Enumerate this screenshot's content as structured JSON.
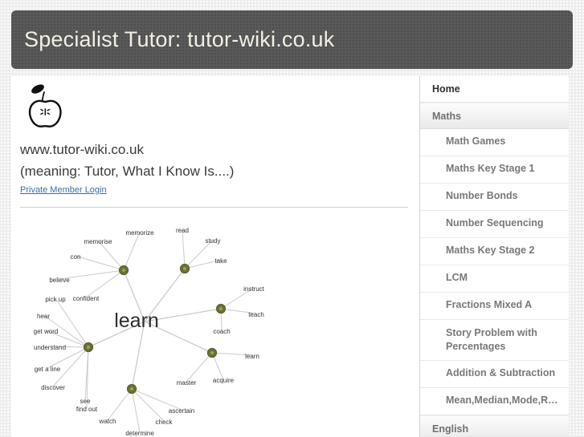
{
  "header": {
    "title": "Specialist Tutor: tutor-wiki.co.uk"
  },
  "logo": {
    "name": "apple-logo",
    "alt": "apple outline with leaf"
  },
  "intro": {
    "url_line": "www.tutor-wiki.co.uk",
    "meaning_line": "(meaning: Tutor, What I Know Is....)",
    "login_link": "Private Member Login"
  },
  "sidebar": {
    "items": [
      {
        "label": "Home",
        "type": "top"
      },
      {
        "label": "Maths",
        "type": "section"
      },
      {
        "label": "Math Games",
        "type": "sub"
      },
      {
        "label": "Maths Key Stage 1",
        "type": "sub"
      },
      {
        "label": "Number Bonds",
        "type": "sub"
      },
      {
        "label": "Number Sequencing",
        "type": "sub"
      },
      {
        "label": "Maths Key Stage 2",
        "type": "sub"
      },
      {
        "label": "LCM",
        "type": "sub"
      },
      {
        "label": "Fractions Mixed A",
        "type": "sub"
      },
      {
        "label": "Story Problem with Percentages",
        "type": "sub"
      },
      {
        "label": "Addition & Subtraction",
        "type": "sub"
      },
      {
        "label": "Mean,Median,Mode,R…",
        "type": "sub"
      },
      {
        "label": "English",
        "type": "section"
      }
    ]
  },
  "mindmap": {
    "center": "learn",
    "node_color": "#6b7030",
    "edge_color": "#cbcbcb",
    "label_color": "#333333",
    "labels": [
      "memorize",
      "memorise",
      "con",
      "believe",
      "confident",
      "read",
      "study",
      "take",
      "instruct",
      "teach",
      "coach",
      "pick up",
      "hear",
      "get word",
      "understand",
      "get a line",
      "discover",
      "see",
      "find out",
      "learn",
      "acquire",
      "master",
      "ascertain",
      "check",
      "watch",
      "determine"
    ]
  },
  "colors": {
    "header_bg": "#59595a",
    "header_text": "#f2f0e4",
    "page_bg": "#ededed",
    "panel_bg": "#ffffff",
    "link": "#3b6ea8",
    "section_text": "#6f7072",
    "sub_text": "#77787a"
  }
}
